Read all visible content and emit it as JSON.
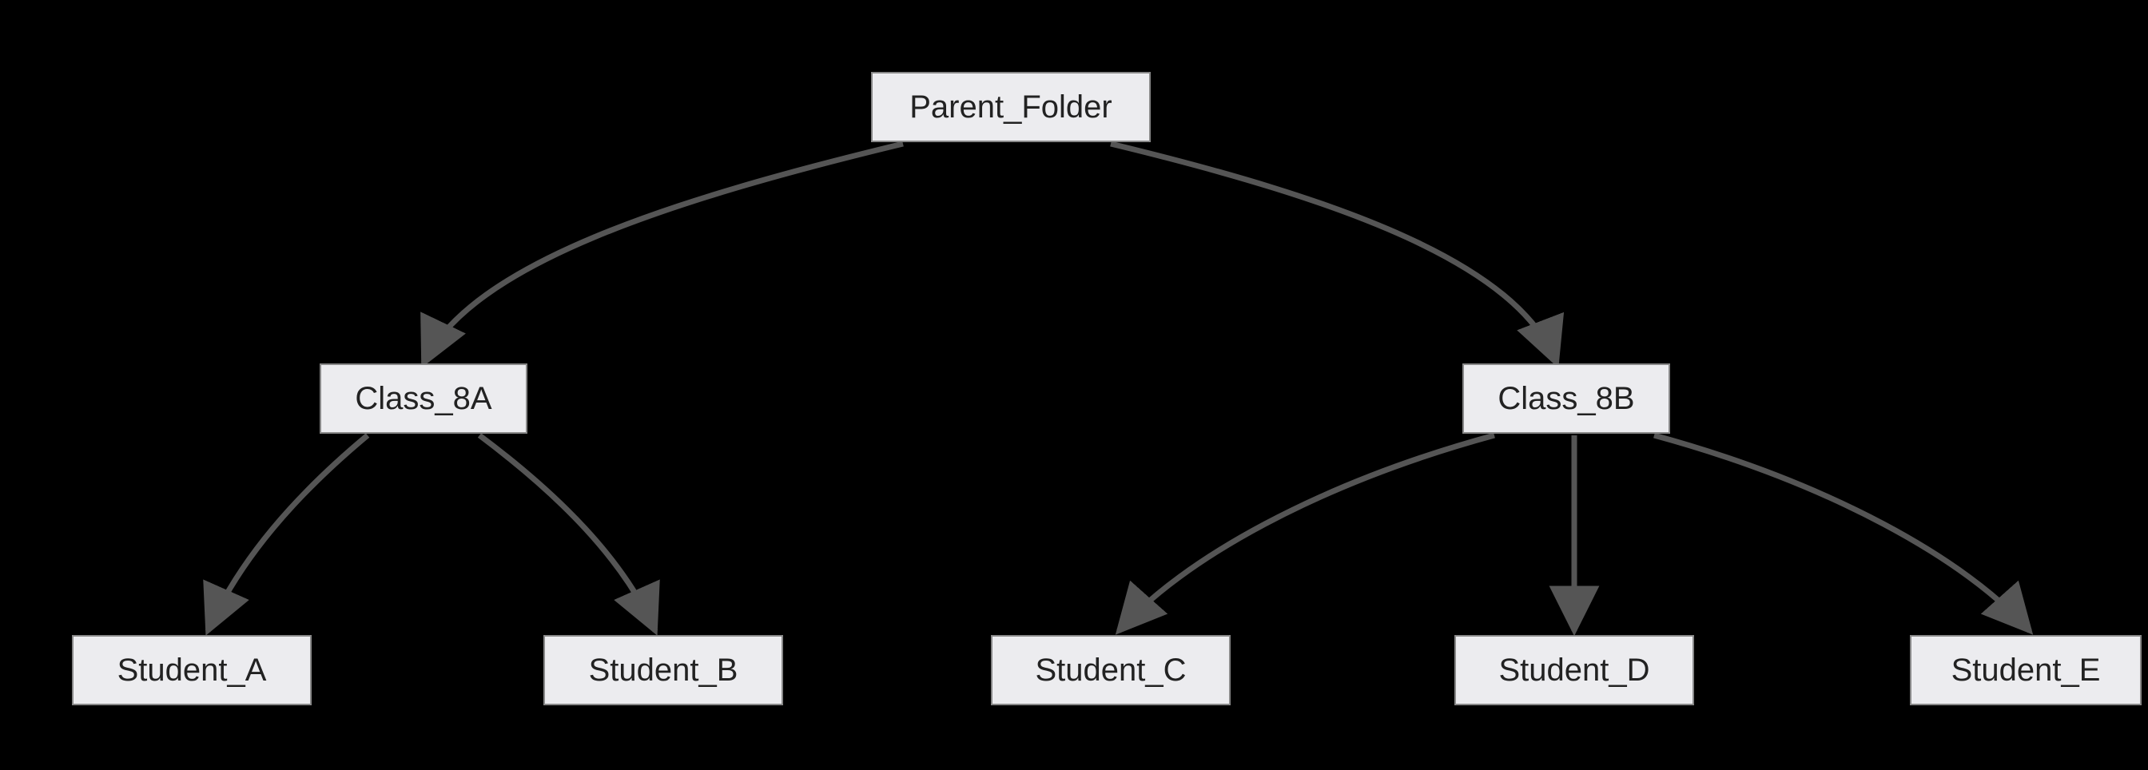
{
  "diagram": {
    "type": "tree",
    "direction": "top-down",
    "root": "parent_folder",
    "nodes": {
      "parent_folder": {
        "label": "Parent_Folder",
        "children": [
          "class_8a",
          "class_8b"
        ]
      },
      "class_8a": {
        "label": "Class_8A",
        "children": [
          "student_a",
          "student_b"
        ]
      },
      "class_8b": {
        "label": "Class_8B",
        "children": [
          "student_c",
          "student_d",
          "student_e"
        ]
      },
      "student_a": {
        "label": "Student_A",
        "children": []
      },
      "student_b": {
        "label": "Student_B",
        "children": []
      },
      "student_c": {
        "label": "Student_C",
        "children": []
      },
      "student_d": {
        "label": "Student_D",
        "children": []
      },
      "student_e": {
        "label": "Student_E",
        "children": []
      }
    },
    "edges": [
      {
        "from": "parent_folder",
        "to": "class_8a"
      },
      {
        "from": "parent_folder",
        "to": "class_8b"
      },
      {
        "from": "class_8a",
        "to": "student_a"
      },
      {
        "from": "class_8a",
        "to": "student_b"
      },
      {
        "from": "class_8b",
        "to": "student_c"
      },
      {
        "from": "class_8b",
        "to": "student_d"
      },
      {
        "from": "class_8b",
        "to": "student_e"
      }
    ]
  }
}
